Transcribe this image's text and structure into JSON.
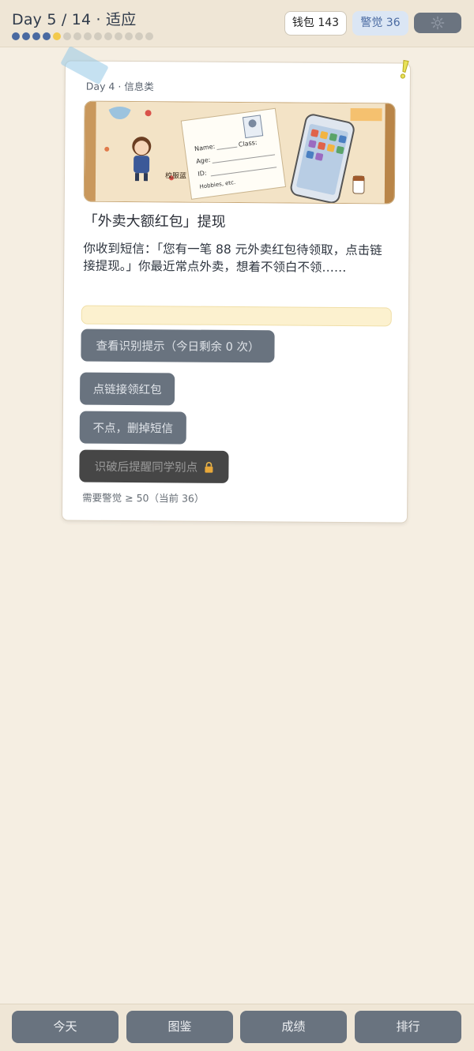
{
  "header": {
    "day_title": "Day 5 / 14 · 适应",
    "progress": {
      "total": 14,
      "completed": 4,
      "current": 5
    },
    "wallet_label": "钱包 143",
    "alertness_label": "警觉 36",
    "settings_icon": "gear-icon"
  },
  "card": {
    "meta": "Day 4 · 信息类",
    "title": "「外卖大额红包」提现",
    "body": "你收到短信：「您有一笔 88 元外卖红包待领取，点击链接提现。」你最近常点外卖，想着不领白不领……",
    "illustration_text": {
      "badge": "校服蓝",
      "name": "Name:",
      "age": "Age:",
      "id": "ID:",
      "hobbies": "Hobbies, etc.",
      "class": "Class:"
    },
    "hint_button": "查看识别提示（今日剩余 0 次）",
    "choices": [
      {
        "label": "点链接领红包",
        "locked": false
      },
      {
        "label": "不点，删掉短信",
        "locked": false
      },
      {
        "label": "识破后提醒同学别点",
        "locked": true
      }
    ],
    "requirement": "需要警觉 ≥ 50（当前 36）"
  },
  "nav": {
    "items": [
      "今天",
      "图鉴",
      "成绩",
      "排行"
    ]
  },
  "colors": {
    "background": "#f5eee2",
    "button": "#69737f",
    "locked_button": "#464646",
    "progress_done": "#4a6aa1",
    "progress_current": "#f2c94c",
    "alert_badge_bg": "#dbe6f4"
  }
}
